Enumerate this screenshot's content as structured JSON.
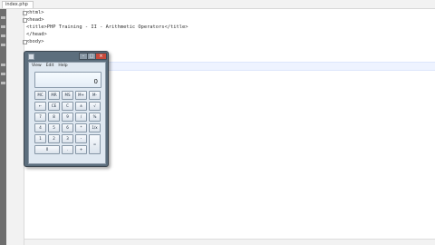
{
  "editor": {
    "tab_label": "index.php",
    "lines": [
      "<html>",
      "<head>",
      "<title>PHP Training - II - Arithmetic Operators</title>",
      "</head>",
      "<body>"
    ]
  },
  "calculator": {
    "menu": [
      "View",
      "Edit",
      "Help"
    ],
    "display_value": "0",
    "keys": {
      "mc": "MC",
      "mr": "MR",
      "ms": "MS",
      "mplus": "M+",
      "mminus": "M-",
      "back": "←",
      "ce": "CE",
      "c": "C",
      "pm": "±",
      "sqrt": "√",
      "n7": "7",
      "n8": "8",
      "n9": "9",
      "div": "/",
      "pct": "%",
      "n4": "4",
      "n5": "5",
      "n6": "6",
      "mul": "*",
      "inv": "1/x",
      "n1": "1",
      "n2": "2",
      "n3": "3",
      "sub": "-",
      "eq": "=",
      "n0": "0",
      "dot": ".",
      "add": "+"
    }
  }
}
